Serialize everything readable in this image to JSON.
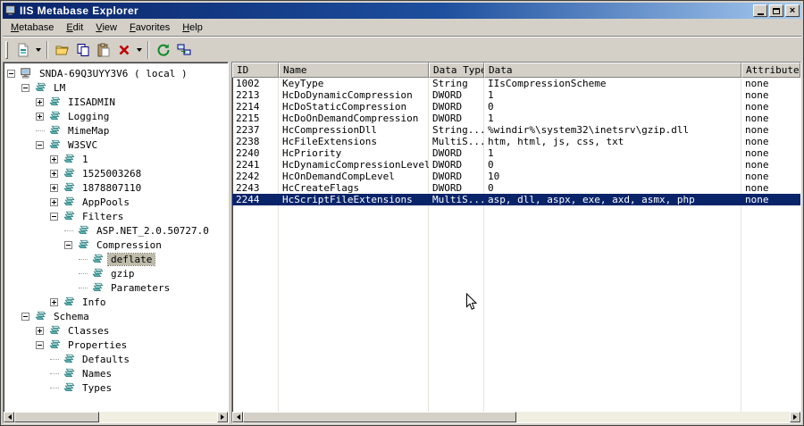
{
  "window": {
    "title": "IIS Metabase Explorer"
  },
  "menu": {
    "items": [
      {
        "label": "Metabase",
        "underline": 0
      },
      {
        "label": "Edit",
        "underline": 0
      },
      {
        "label": "View",
        "underline": 0
      },
      {
        "label": "Favorites",
        "underline": 0
      },
      {
        "label": "Help",
        "underline": 0
      }
    ]
  },
  "toolbar": {
    "items": [
      {
        "type": "button",
        "name": "new-record-button",
        "icon": "new-key-icon",
        "dropdown": true
      },
      {
        "type": "separator"
      },
      {
        "type": "button",
        "name": "open-button",
        "icon": "open-folder-icon"
      },
      {
        "type": "button",
        "name": "copy-button",
        "icon": "copy-icon"
      },
      {
        "type": "button",
        "name": "paste-button",
        "icon": "paste-icon"
      },
      {
        "type": "button",
        "name": "delete-button",
        "icon": "delete-icon",
        "dropdown": true
      },
      {
        "type": "separator"
      },
      {
        "type": "button",
        "name": "refresh-button",
        "icon": "refresh-icon"
      },
      {
        "type": "button",
        "name": "connect-button",
        "icon": "network-icon"
      }
    ]
  },
  "tree": {
    "items": [
      {
        "label": "SNDA-69Q3UYY3V6 ( local )",
        "depth": 0,
        "toggle": "minus",
        "icon": "computer-icon"
      },
      {
        "label": "LM",
        "depth": 1,
        "toggle": "minus",
        "icon": "metabase-key-icon"
      },
      {
        "label": "IISADMIN",
        "depth": 2,
        "toggle": "plus",
        "icon": "metabase-key-icon"
      },
      {
        "label": "Logging",
        "depth": 2,
        "toggle": "plus",
        "icon": "metabase-key-icon"
      },
      {
        "label": "MimeMap",
        "depth": 2,
        "toggle": "none",
        "icon": "metabase-key-icon"
      },
      {
        "label": "W3SVC",
        "depth": 2,
        "toggle": "minus",
        "icon": "metabase-key-icon"
      },
      {
        "label": "1",
        "depth": 3,
        "toggle": "plus",
        "icon": "metabase-key-icon"
      },
      {
        "label": "1525003268",
        "depth": 3,
        "toggle": "plus",
        "icon": "metabase-key-icon"
      },
      {
        "label": "1878807110",
        "depth": 3,
        "toggle": "plus",
        "icon": "metabase-key-icon"
      },
      {
        "label": "AppPools",
        "depth": 3,
        "toggle": "plus",
        "icon": "metabase-key-icon"
      },
      {
        "label": "Filters",
        "depth": 3,
        "toggle": "minus",
        "icon": "metabase-key-icon"
      },
      {
        "label": "ASP.NET_2.0.50727.0",
        "depth": 4,
        "toggle": "none",
        "icon": "metabase-key-icon"
      },
      {
        "label": "Compression",
        "depth": 4,
        "toggle": "minus",
        "icon": "metabase-key-icon"
      },
      {
        "label": "deflate",
        "depth": 5,
        "toggle": "none",
        "icon": "metabase-key-icon",
        "selected": true
      },
      {
        "label": "gzip",
        "depth": 5,
        "toggle": "none",
        "icon": "metabase-key-icon"
      },
      {
        "label": "Parameters",
        "depth": 5,
        "toggle": "none",
        "icon": "metabase-key-icon"
      },
      {
        "label": "Info",
        "depth": 3,
        "toggle": "plus",
        "icon": "metabase-key-icon"
      },
      {
        "label": "Schema",
        "depth": 1,
        "toggle": "minus",
        "icon": "metabase-key-icon"
      },
      {
        "label": "Classes",
        "depth": 2,
        "toggle": "plus",
        "icon": "metabase-key-icon"
      },
      {
        "label": "Properties",
        "depth": 2,
        "toggle": "minus",
        "icon": "metabase-key-icon"
      },
      {
        "label": "Defaults",
        "depth": 3,
        "toggle": "none",
        "icon": "metabase-key-icon"
      },
      {
        "label": "Names",
        "depth": 3,
        "toggle": "none",
        "icon": "metabase-key-icon"
      },
      {
        "label": "Types",
        "depth": 3,
        "toggle": "none",
        "icon": "metabase-key-icon"
      }
    ]
  },
  "table": {
    "columns": [
      "ID",
      "Name",
      "Data Type",
      "Data",
      "Attributes"
    ],
    "rows": [
      [
        "1002",
        "KeyType",
        "String",
        "IIsCompressionScheme",
        "none"
      ],
      [
        "2213",
        "HcDoDynamicCompression",
        "DWORD",
        "1",
        "none"
      ],
      [
        "2214",
        "HcDoStaticCompression",
        "DWORD",
        "0",
        "none"
      ],
      [
        "2215",
        "HcDoOnDemandCompression",
        "DWORD",
        "1",
        "none"
      ],
      [
        "2237",
        "HcCompressionDll",
        "String...",
        "%windir%\\system32\\inetsrv\\gzip.dll",
        "none"
      ],
      [
        "2238",
        "HcFileExtensions",
        "MultiS...",
        "htm, html, js, css, txt",
        "none"
      ],
      [
        "2240",
        "HcPriority",
        "DWORD",
        "1",
        "none"
      ],
      [
        "2241",
        "HcDynamicCompressionLevel",
        "DWORD",
        "0",
        "none"
      ],
      [
        "2242",
        "HcOnDemandCompLevel",
        "DWORD",
        "10",
        "none"
      ],
      [
        "2243",
        "HcCreateFlags",
        "DWORD",
        "0",
        "none"
      ],
      [
        "2244",
        "HcScriptFileExtensions",
        "MultiS...",
        "asp, dll, aspx, exe, axd, asmx, php",
        "none"
      ]
    ],
    "selected_row_index": 10
  },
  "colors": {
    "selection": "#0a246a",
    "titlebar_start": "#0a246a",
    "titlebar_end": "#a6caf0",
    "chrome": "#d4d0c8"
  }
}
